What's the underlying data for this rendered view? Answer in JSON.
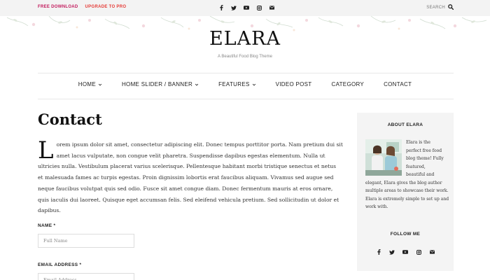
{
  "topbar": {
    "free_download": "FREE DOWNLOAD",
    "upgrade": "UPGRADE TO PRO",
    "search_label": "SEARCH",
    "social_icons": [
      "facebook-icon",
      "twitter-icon",
      "youtube-icon",
      "instagram-icon",
      "email-icon"
    ]
  },
  "brand": {
    "logo": "ELARA",
    "tagline": "A Beautiful Food Blog Theme"
  },
  "nav": {
    "items": [
      {
        "label": "HOME",
        "dropdown": true
      },
      {
        "label": "HOME SLIDER / BANNER",
        "dropdown": true
      },
      {
        "label": "FEATURES",
        "dropdown": true
      },
      {
        "label": "VIDEO POST",
        "dropdown": false
      },
      {
        "label": "CATEGORY",
        "dropdown": false
      },
      {
        "label": "CONTACT",
        "dropdown": false
      }
    ]
  },
  "main": {
    "title": "Contact",
    "dropcap": "L",
    "body": "orem ipsum dolor sit amet, consectetur adipiscing elit. Donec tempus porttitor porta. Nam pretium dui sit amet lacus vulputate, non congue velit pharetra. Suspendisse dapibus egestas elementum. Nulla ut ultricies nulla. Vestibulum placerat varius scelerisque. Pellentesque habitant morbi tristique senectus et netus et malesuada fames ac turpis egestas. Proin dignissim lobortis erat faucibus aliquam. Vivamus sed augue sed neque faucibus volutpat quis sed odio. Fusce sit amet congue diam. Donec fermentum mauris at eros ornare, quis iaculis dui laoreet. Quisque eget accumsan felis. Sed eleifend vehicula pretium. Sed sollicitudin ut dolor et dapibus.",
    "form": {
      "name_label": "NAME *",
      "name_placeholder": "Full Name",
      "email_label": "EMAIL ADDRESS *",
      "email_placeholder": "Email Address"
    }
  },
  "sidebar": {
    "about_title": "ABOUT ELARA",
    "about_lines": [
      "Elara is the",
      "perfect free food",
      "blog theme! Fully",
      "featured,",
      "beautiful and",
      "elegant, Elara gives the blog author",
      "multiple areas to showcase their work.",
      "Elara is extremely simple to set up and",
      "work with."
    ],
    "follow_title": "FOLLOW ME",
    "social_icons": [
      "facebook-icon",
      "twitter-icon",
      "youtube-icon",
      "instagram-icon",
      "email-icon"
    ]
  },
  "colors": {
    "free_download": "#c2185b",
    "upgrade": "#e53935",
    "sidebar_bg": "#f4f4f4",
    "topbar_bg": "#f3f3f3"
  }
}
